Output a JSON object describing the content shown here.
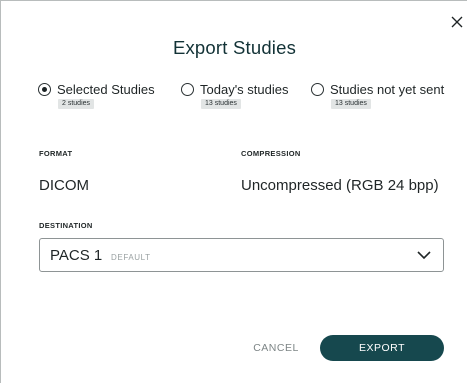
{
  "dialog": {
    "title": "Export Studies",
    "close_icon": "close-icon"
  },
  "scope_options": [
    {
      "label": "Selected Studies",
      "badge": "2 studies",
      "selected": true
    },
    {
      "label": "Today's studies",
      "badge": "13 studies",
      "selected": false
    },
    {
      "label": "Studies not yet sent",
      "badge": "13 studies",
      "selected": false
    }
  ],
  "format": {
    "label": "FORMAT",
    "value": "DICOM"
  },
  "compression": {
    "label": "COMPRESSION",
    "value": "Uncompressed (RGB 24 bpp)"
  },
  "destination": {
    "label": "DESTINATION",
    "value": "PACS 1",
    "tag": "DEFAULT",
    "icon": "chevron-down-icon"
  },
  "actions": {
    "cancel_label": "CANCEL",
    "export_label": "EXPORT",
    "export_color": "#16484e"
  }
}
